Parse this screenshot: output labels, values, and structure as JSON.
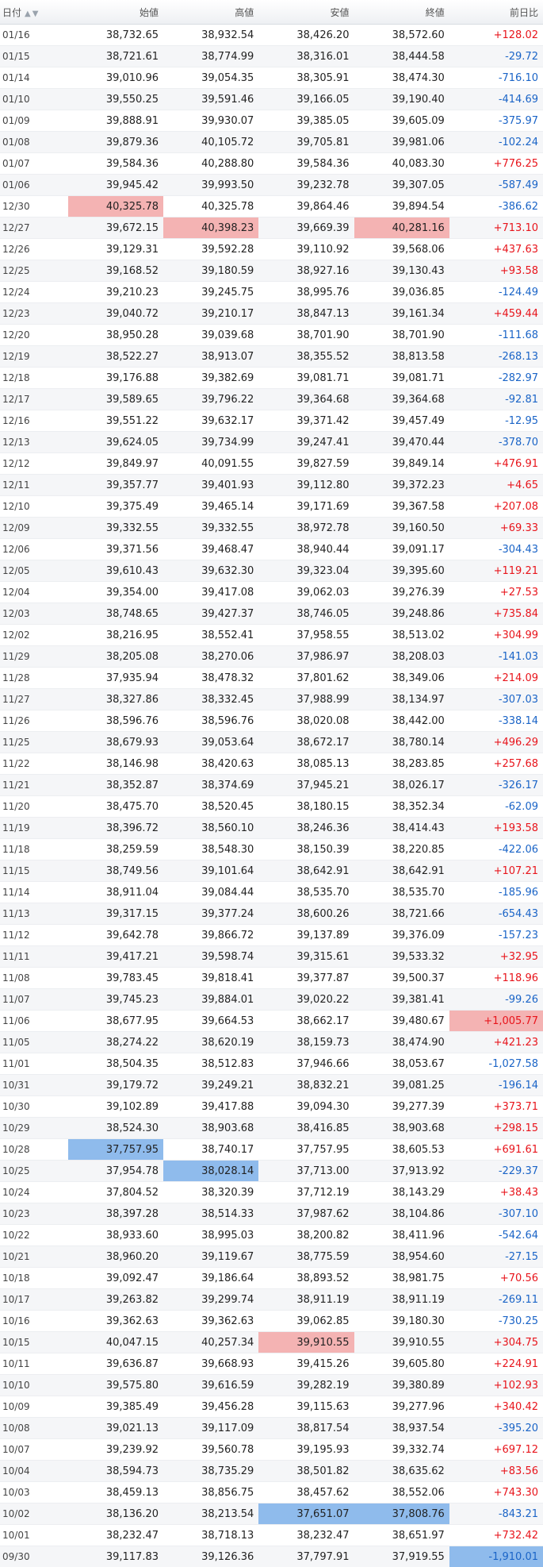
{
  "header": {
    "date": "日付",
    "open": "始値",
    "high": "高値",
    "low": "安値",
    "close": "終値",
    "change": "前日比",
    "sort_icon": "▲▼"
  },
  "colors": {
    "up": "#e8141b",
    "down": "#1a64c7",
    "highlight_high": "#f4b3b3",
    "highlight_low": "#8fbbec"
  },
  "rows": [
    [
      "01/16",
      "38,732.65",
      "38,932.54",
      "38,426.20",
      "38,572.60",
      "+128.02"
    ],
    [
      "01/15",
      "38,721.61",
      "38,774.99",
      "38,316.01",
      "38,444.58",
      "-29.72"
    ],
    [
      "01/14",
      "39,010.96",
      "39,054.35",
      "38,305.91",
      "38,474.30",
      "-716.10"
    ],
    [
      "01/10",
      "39,550.25",
      "39,591.46",
      "39,166.05",
      "39,190.40",
      "-414.69"
    ],
    [
      "01/09",
      "39,888.91",
      "39,930.07",
      "39,385.05",
      "39,605.09",
      "-375.97"
    ],
    [
      "01/08",
      "39,879.36",
      "40,105.72",
      "39,705.81",
      "39,981.06",
      "-102.24"
    ],
    [
      "01/07",
      "39,584.36",
      "40,288.80",
      "39,584.36",
      "40,083.30",
      "+776.25"
    ],
    [
      "01/06",
      "39,945.42",
      "39,993.50",
      "39,232.78",
      "39,307.05",
      "-587.49"
    ],
    [
      "12/30",
      "40,325.78",
      "40,325.78",
      "39,864.46",
      "39,894.54",
      "-386.62"
    ],
    [
      "12/27",
      "39,672.15",
      "40,398.23",
      "39,669.39",
      "40,281.16",
      "+713.10"
    ],
    [
      "12/26",
      "39,129.31",
      "39,592.28",
      "39,110.92",
      "39,568.06",
      "+437.63"
    ],
    [
      "12/25",
      "39,168.52",
      "39,180.59",
      "38,927.16",
      "39,130.43",
      "+93.58"
    ],
    [
      "12/24",
      "39,210.23",
      "39,245.75",
      "38,995.76",
      "39,036.85",
      "-124.49"
    ],
    [
      "12/23",
      "39,040.72",
      "39,210.17",
      "38,847.13",
      "39,161.34",
      "+459.44"
    ],
    [
      "12/20",
      "38,950.28",
      "39,039.68",
      "38,701.90",
      "38,701.90",
      "-111.68"
    ],
    [
      "12/19",
      "38,522.27",
      "38,913.07",
      "38,355.52",
      "38,813.58",
      "-268.13"
    ],
    [
      "12/18",
      "39,176.88",
      "39,382.69",
      "39,081.71",
      "39,081.71",
      "-282.97"
    ],
    [
      "12/17",
      "39,589.65",
      "39,796.22",
      "39,364.68",
      "39,364.68",
      "-92.81"
    ],
    [
      "12/16",
      "39,551.22",
      "39,632.17",
      "39,371.42",
      "39,457.49",
      "-12.95"
    ],
    [
      "12/13",
      "39,624.05",
      "39,734.99",
      "39,247.41",
      "39,470.44",
      "-378.70"
    ],
    [
      "12/12",
      "39,849.97",
      "40,091.55",
      "39,827.59",
      "39,849.14",
      "+476.91"
    ],
    [
      "12/11",
      "39,357.77",
      "39,401.93",
      "39,112.80",
      "39,372.23",
      "+4.65"
    ],
    [
      "12/10",
      "39,375.49",
      "39,465.14",
      "39,171.69",
      "39,367.58",
      "+207.08"
    ],
    [
      "12/09",
      "39,332.55",
      "39,332.55",
      "38,972.78",
      "39,160.50",
      "+69.33"
    ],
    [
      "12/06",
      "39,371.56",
      "39,468.47",
      "38,940.44",
      "39,091.17",
      "-304.43"
    ],
    [
      "12/05",
      "39,610.43",
      "39,632.30",
      "39,323.04",
      "39,395.60",
      "+119.21"
    ],
    [
      "12/04",
      "39,354.00",
      "39,417.08",
      "39,062.03",
      "39,276.39",
      "+27.53"
    ],
    [
      "12/03",
      "38,748.65",
      "39,427.37",
      "38,746.05",
      "39,248.86",
      "+735.84"
    ],
    [
      "12/02",
      "38,216.95",
      "38,552.41",
      "37,958.55",
      "38,513.02",
      "+304.99"
    ],
    [
      "11/29",
      "38,205.08",
      "38,270.06",
      "37,986.97",
      "38,208.03",
      "-141.03"
    ],
    [
      "11/28",
      "37,935.94",
      "38,478.32",
      "37,801.62",
      "38,349.06",
      "+214.09"
    ],
    [
      "11/27",
      "38,327.86",
      "38,332.45",
      "37,988.99",
      "38,134.97",
      "-307.03"
    ],
    [
      "11/26",
      "38,596.76",
      "38,596.76",
      "38,020.08",
      "38,442.00",
      "-338.14"
    ],
    [
      "11/25",
      "38,679.93",
      "39,053.64",
      "38,672.17",
      "38,780.14",
      "+496.29"
    ],
    [
      "11/22",
      "38,146.98",
      "38,420.63",
      "38,085.13",
      "38,283.85",
      "+257.68"
    ],
    [
      "11/21",
      "38,352.87",
      "38,374.69",
      "37,945.21",
      "38,026.17",
      "-326.17"
    ],
    [
      "11/20",
      "38,475.70",
      "38,520.45",
      "38,180.15",
      "38,352.34",
      "-62.09"
    ],
    [
      "11/19",
      "38,396.72",
      "38,560.10",
      "38,246.36",
      "38,414.43",
      "+193.58"
    ],
    [
      "11/18",
      "38,259.59",
      "38,548.30",
      "38,150.39",
      "38,220.85",
      "-422.06"
    ],
    [
      "11/15",
      "38,749.56",
      "39,101.64",
      "38,642.91",
      "38,642.91",
      "+107.21"
    ],
    [
      "11/14",
      "38,911.04",
      "39,084.44",
      "38,535.70",
      "38,535.70",
      "-185.96"
    ],
    [
      "11/13",
      "39,317.15",
      "39,377.24",
      "38,600.26",
      "38,721.66",
      "-654.43"
    ],
    [
      "11/12",
      "39,642.78",
      "39,866.72",
      "39,137.89",
      "39,376.09",
      "-157.23"
    ],
    [
      "11/11",
      "39,417.21",
      "39,598.74",
      "39,315.61",
      "39,533.32",
      "+32.95"
    ],
    [
      "11/08",
      "39,783.45",
      "39,818.41",
      "39,377.87",
      "39,500.37",
      "+118.96"
    ],
    [
      "11/07",
      "39,745.23",
      "39,884.01",
      "39,020.22",
      "39,381.41",
      "-99.26"
    ],
    [
      "11/06",
      "38,677.95",
      "39,664.53",
      "38,662.17",
      "39,480.67",
      "+1,005.77"
    ],
    [
      "11/05",
      "38,274.22",
      "38,620.19",
      "38,159.73",
      "38,474.90",
      "+421.23"
    ],
    [
      "11/01",
      "38,504.35",
      "38,512.83",
      "37,946.66",
      "38,053.67",
      "-1,027.58"
    ],
    [
      "10/31",
      "39,179.72",
      "39,249.21",
      "38,832.21",
      "39,081.25",
      "-196.14"
    ],
    [
      "10/30",
      "39,102.89",
      "39,417.88",
      "39,094.30",
      "39,277.39",
      "+373.71"
    ],
    [
      "10/29",
      "38,524.30",
      "38,903.68",
      "38,416.85",
      "38,903.68",
      "+298.15"
    ],
    [
      "10/28",
      "37,757.95",
      "38,740.17",
      "37,757.95",
      "38,605.53",
      "+691.61"
    ],
    [
      "10/25",
      "37,954.78",
      "38,028.14",
      "37,713.00",
      "37,913.92",
      "-229.37"
    ],
    [
      "10/24",
      "37,804.52",
      "38,320.39",
      "37,712.19",
      "38,143.29",
      "+38.43"
    ],
    [
      "10/23",
      "38,397.28",
      "38,514.33",
      "37,987.62",
      "38,104.86",
      "-307.10"
    ],
    [
      "10/22",
      "38,933.60",
      "38,995.03",
      "38,200.82",
      "38,411.96",
      "-542.64"
    ],
    [
      "10/21",
      "38,960.20",
      "39,119.67",
      "38,775.59",
      "38,954.60",
      "-27.15"
    ],
    [
      "10/18",
      "39,092.47",
      "39,186.64",
      "38,893.52",
      "38,981.75",
      "+70.56"
    ],
    [
      "10/17",
      "39,263.82",
      "39,299.74",
      "38,911.19",
      "38,911.19",
      "-269.11"
    ],
    [
      "10/16",
      "39,362.63",
      "39,362.63",
      "39,062.85",
      "39,180.30",
      "-730.25"
    ],
    [
      "10/15",
      "40,047.15",
      "40,257.34",
      "39,910.55",
      "39,910.55",
      "+304.75"
    ],
    [
      "10/11",
      "39,636.87",
      "39,668.93",
      "39,415.26",
      "39,605.80",
      "+224.91"
    ],
    [
      "10/10",
      "39,575.80",
      "39,616.59",
      "39,282.19",
      "39,380.89",
      "+102.93"
    ],
    [
      "10/09",
      "39,385.49",
      "39,456.28",
      "39,115.63",
      "39,277.96",
      "+340.42"
    ],
    [
      "10/08",
      "39,021.13",
      "39,117.09",
      "38,817.54",
      "38,937.54",
      "-395.20"
    ],
    [
      "10/07",
      "39,239.92",
      "39,560.78",
      "39,195.93",
      "39,332.74",
      "+697.12"
    ],
    [
      "10/04",
      "38,594.73",
      "38,735.29",
      "38,501.82",
      "38,635.62",
      "+83.56"
    ],
    [
      "10/03",
      "38,459.13",
      "38,856.75",
      "38,457.62",
      "38,552.06",
      "+743.30"
    ],
    [
      "10/02",
      "38,136.20",
      "38,213.54",
      "37,651.07",
      "37,808.76",
      "-843.21"
    ],
    [
      "10/01",
      "38,232.47",
      "38,718.13",
      "38,232.47",
      "38,651.97",
      "+732.42"
    ],
    [
      "09/30",
      "39,117.83",
      "39,126.36",
      "37,797.91",
      "37,919.55",
      "-1,910.01"
    ]
  ],
  "highlights": {
    "high": [
      [
        8,
        1
      ],
      [
        9,
        2
      ],
      [
        9,
        4
      ],
      [
        46,
        5
      ],
      [
        61,
        3
      ]
    ],
    "low": [
      [
        52,
        1
      ],
      [
        53,
        2
      ],
      [
        69,
        3
      ],
      [
        69,
        4
      ],
      [
        71,
        5
      ]
    ]
  }
}
